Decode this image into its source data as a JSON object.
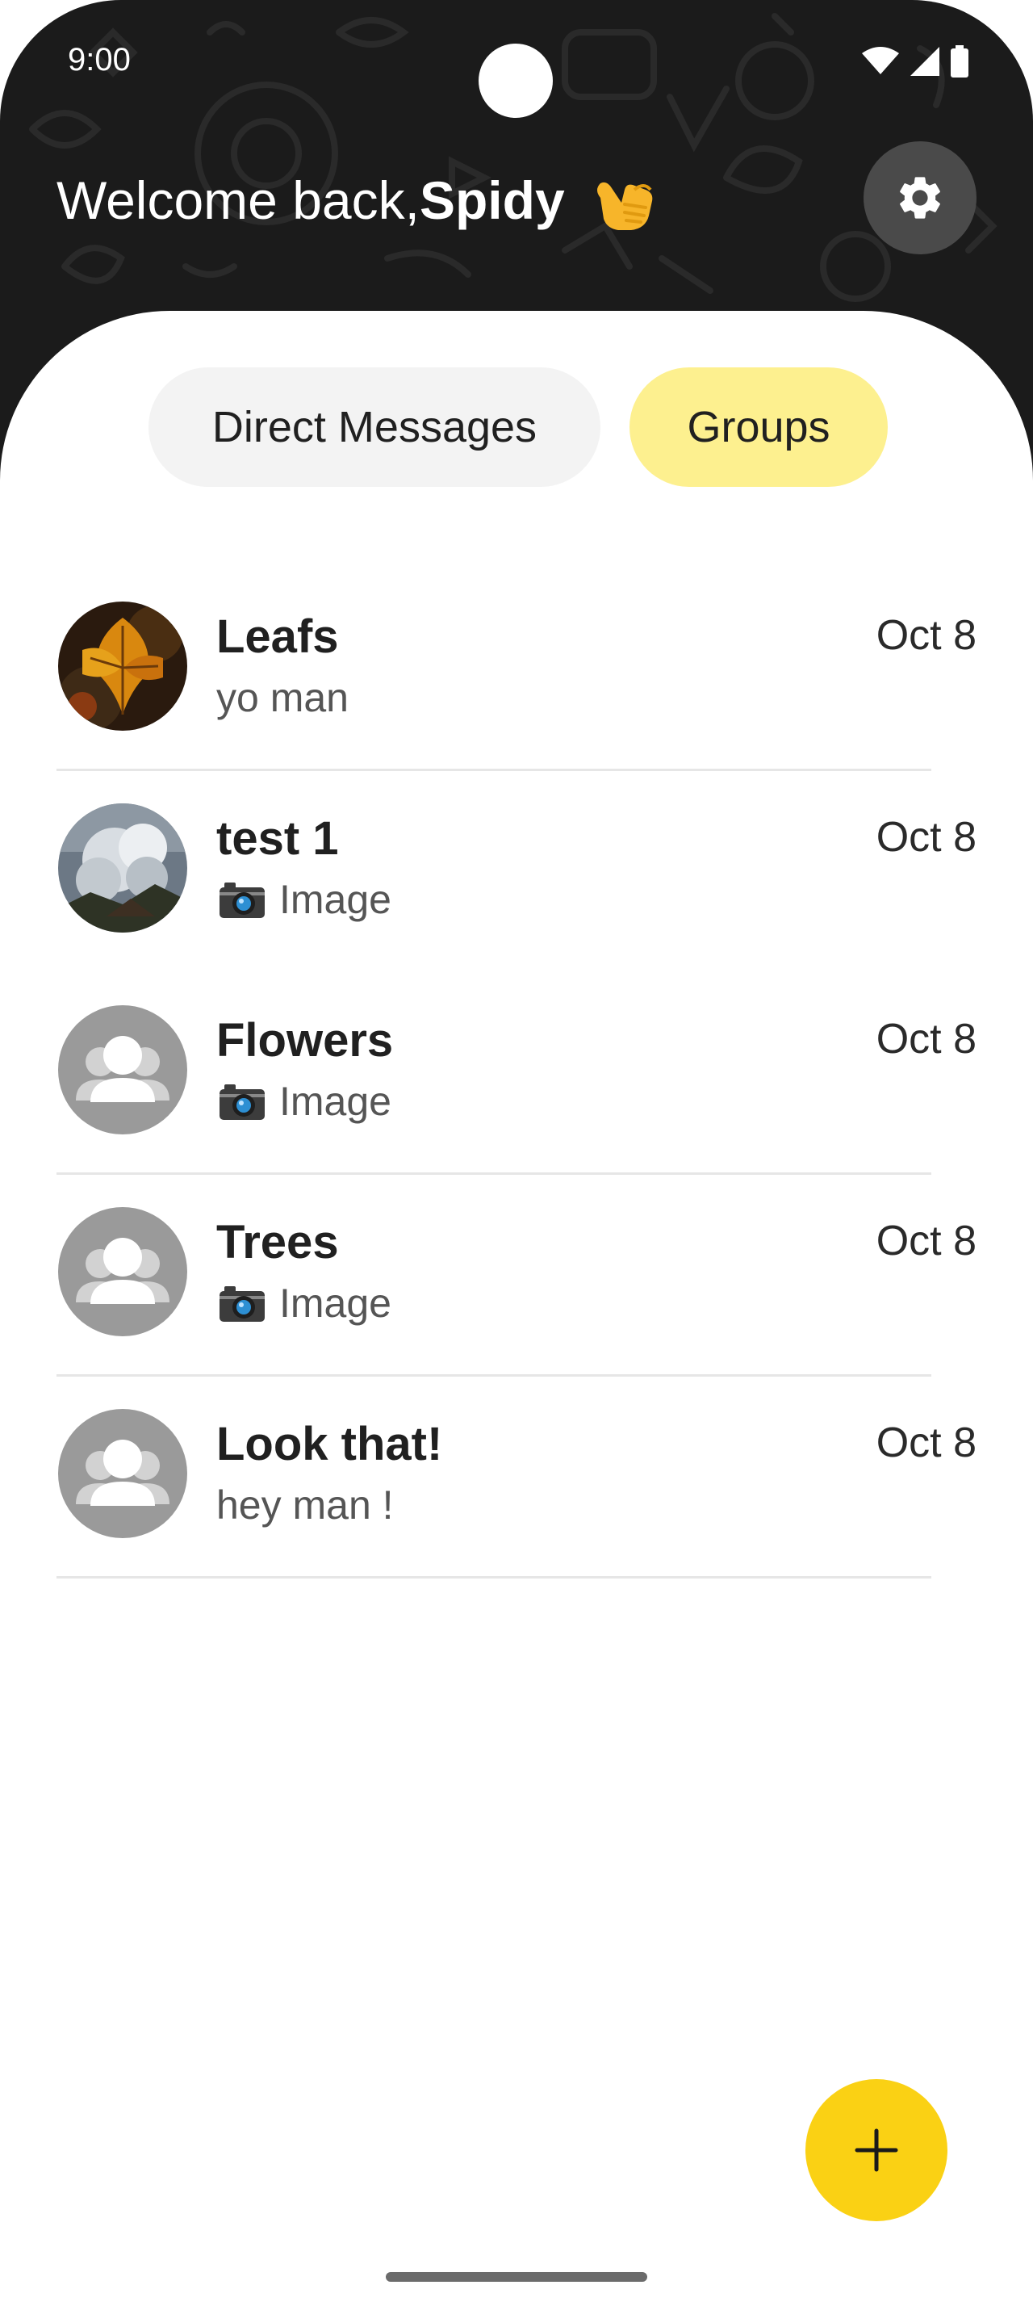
{
  "status_bar": {
    "time": "9:00",
    "wifi_icon": "wifi-icon",
    "signal_icon": "signal-icon",
    "battery_icon": "battery-icon"
  },
  "header": {
    "welcome_text": "Welcome back,",
    "user_name": "Spidy",
    "wave_icon": "call-me-hand-icon",
    "settings_icon": "gear-icon"
  },
  "tabs": [
    {
      "label": "Direct Messages",
      "selected": false
    },
    {
      "label": "Groups",
      "selected": true
    }
  ],
  "chats": [
    {
      "name": "Leafs",
      "preview": "yo man",
      "date": "Oct 8",
      "avatar": "autumn-leaf-photo",
      "preview_icon": ""
    },
    {
      "name": "test 1",
      "preview": "Image",
      "date": "Oct 8",
      "avatar": "cloudy-mountain-photo",
      "preview_icon": "camera-icon"
    },
    {
      "name": "Flowers",
      "preview": "Image",
      "date": "Oct 8",
      "avatar": "group-placeholder-icon",
      "preview_icon": "camera-icon"
    },
    {
      "name": "Trees",
      "preview": "Image",
      "date": "Oct 8",
      "avatar": "group-placeholder-icon",
      "preview_icon": "camera-icon"
    },
    {
      "name": "Look that!",
      "preview": "hey man !",
      "date": "Oct 8",
      "avatar": "group-placeholder-icon",
      "preview_icon": ""
    }
  ],
  "fab": {
    "icon": "plus-icon"
  },
  "colors": {
    "header_bg": "#1b1b1b",
    "accent_yellow": "#fad114",
    "selected_tab": "#fdf08f",
    "unselected_tab": "#f3f3f3",
    "placeholder_avatar": "#9a9a9a"
  }
}
